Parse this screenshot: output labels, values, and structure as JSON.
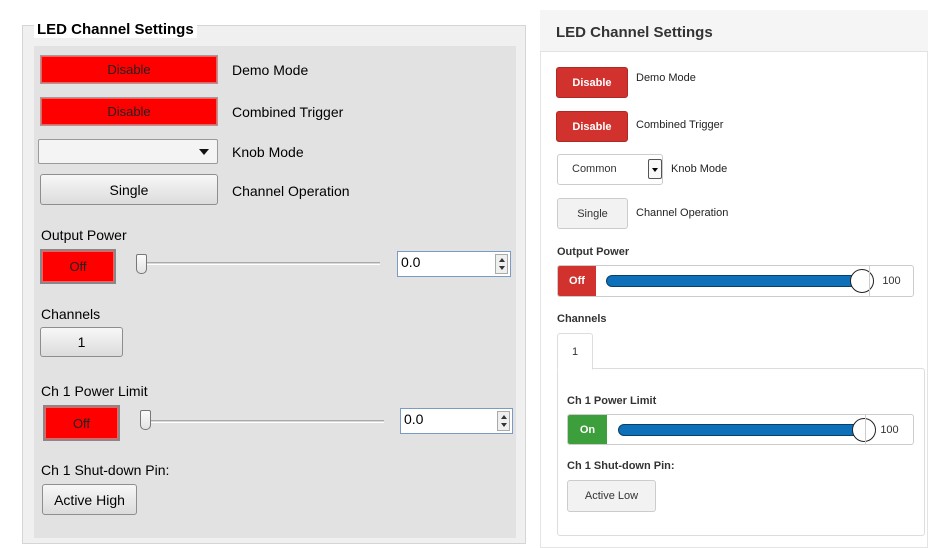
{
  "left": {
    "title": "LED Channel Settings",
    "demo_mode": {
      "button": "Disable",
      "label": "Demo Mode"
    },
    "combined_trigger": {
      "button": "Disable",
      "label": "Combined Trigger"
    },
    "knob_mode": {
      "value": "",
      "label": "Knob Mode"
    },
    "channel_operation": {
      "button": "Single",
      "label": "Channel Operation"
    },
    "output_power": {
      "heading": "Output Power",
      "button": "Off",
      "value": "0.0",
      "level": 0
    },
    "channels": {
      "heading": "Channels",
      "tab": "1"
    },
    "ch1_power_limit": {
      "heading": "Ch 1 Power Limit",
      "button": "Off",
      "value": "0.0",
      "level": 0
    },
    "ch1_shutdown": {
      "heading": "Ch 1 Shut-down Pin:",
      "button": "Active High"
    }
  },
  "right": {
    "title": "LED Channel Settings",
    "demo_mode": {
      "button": "Disable",
      "label": "Demo Mode"
    },
    "combined_trigger": {
      "button": "Disable",
      "label": "Combined Trigger"
    },
    "knob_mode": {
      "value": "Common",
      "label": "Knob Mode"
    },
    "channel_operation": {
      "button": "Single",
      "label": "Channel Operation"
    },
    "output_power": {
      "heading": "Output Power",
      "button": "Off",
      "value": "100",
      "level": 100
    },
    "channels": {
      "heading": "Channels",
      "tab": "1"
    },
    "ch1_power_limit": {
      "heading": "Ch 1 Power Limit",
      "button": "On",
      "value": "100",
      "level": 100
    },
    "ch1_shutdown": {
      "heading": "Ch 1 Shut-down Pin:",
      "button": "Active Low"
    }
  },
  "colors": {
    "win_red": "#ff0000",
    "bs_danger": "#d2322d",
    "bs_success": "#3c9f3c",
    "slider_blue": "#0e70b8"
  },
  "icons": [
    "chevron-down-icon",
    "spin-up-icon",
    "spin-down-icon"
  ]
}
